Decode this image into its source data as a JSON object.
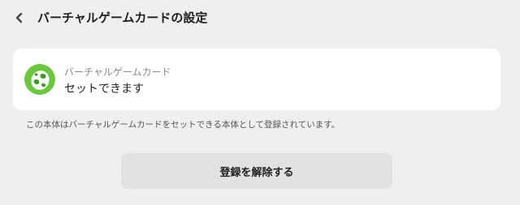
{
  "header": {
    "back_icon": "chevron-left-icon",
    "title": "バーチャルゲームカードの設定"
  },
  "card": {
    "icon": "yoshi-egg-icon",
    "label": "バーチャルゲームカード",
    "value": "セットできます"
  },
  "description": "この本体はバーチャルゲームカードをセットできる本体として登録されています。",
  "unregister_button": {
    "label": "登録を解除する"
  },
  "colors": {
    "background": "#efefef",
    "card": "#ffffff",
    "button": "#e2e2e2",
    "icon_green": "#6cc63f"
  }
}
